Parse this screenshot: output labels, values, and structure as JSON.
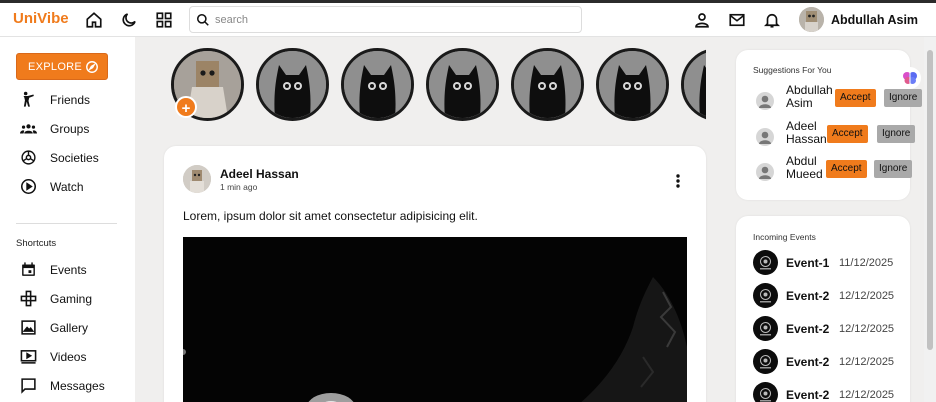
{
  "app": {
    "logo": "UniVibe"
  },
  "header": {
    "search_placeholder": "search",
    "user_name": "Abdullah Asim"
  },
  "sidebar": {
    "explore_label": "EXPLORE",
    "items": [
      {
        "label": "Friends",
        "icon": "person-icon"
      },
      {
        "label": "Groups",
        "icon": "groups-icon"
      },
      {
        "label": "Societies",
        "icon": "societies-icon"
      },
      {
        "label": "Watch",
        "icon": "play-icon"
      }
    ],
    "shortcuts_title": "Shortcuts",
    "shortcuts": [
      {
        "label": "Events",
        "icon": "calendar-icon"
      },
      {
        "label": "Gaming",
        "icon": "gamepad-icon"
      },
      {
        "label": "Gallery",
        "icon": "image-icon"
      },
      {
        "label": "Videos",
        "icon": "video-icon"
      },
      {
        "label": "Messages",
        "icon": "message-icon"
      }
    ]
  },
  "post": {
    "author": "Adeel Hassan",
    "time": "1 min ago",
    "text": "Lorem, ipsum dolor sit amet consectetur adipisicing elit."
  },
  "suggestions": {
    "title": "Suggestions For You",
    "accept_label": "Accept",
    "ignore_label": "Ignore",
    "items": [
      {
        "first": "Abdullah",
        "last": "Asim"
      },
      {
        "first": "Adeel",
        "last": "Hassan"
      },
      {
        "first": "Abdul",
        "last": "Mueed"
      }
    ]
  },
  "events": {
    "title": "Incoming Events",
    "items": [
      {
        "name": "Event-1",
        "date": "11/12/2025"
      },
      {
        "name": "Event-2",
        "date": "12/12/2025"
      },
      {
        "name": "Event-2",
        "date": "12/12/2025"
      },
      {
        "name": "Event-2",
        "date": "12/12/2025"
      },
      {
        "name": "Event-2",
        "date": "12/12/2025"
      }
    ]
  },
  "colors": {
    "accent": "#f07b1c",
    "ignore": "#a9a9a9",
    "background": "#f0efee"
  }
}
